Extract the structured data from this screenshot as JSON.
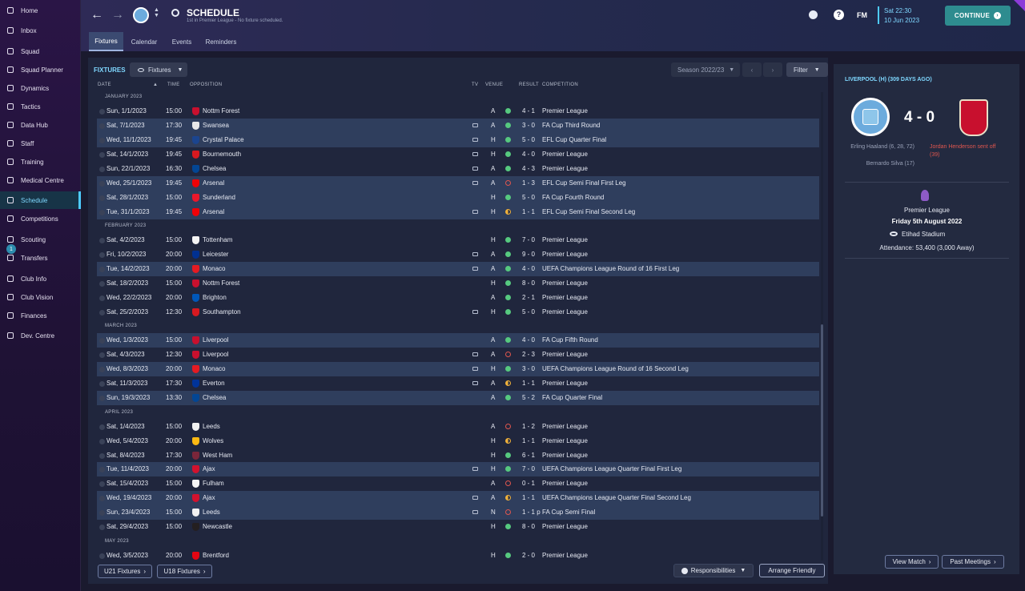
{
  "sidebar": {
    "items": [
      {
        "label": "Home",
        "icon": "home-icon"
      },
      {
        "label": "Inbox",
        "icon": "inbox-icon"
      },
      {
        "label": "Squad",
        "icon": "squad-icon"
      },
      {
        "label": "Squad Planner",
        "icon": "planner-icon"
      },
      {
        "label": "Dynamics",
        "icon": "dynamics-icon"
      },
      {
        "label": "Tactics",
        "icon": "tactics-icon"
      },
      {
        "label": "Data Hub",
        "icon": "data-hub-icon"
      },
      {
        "label": "Staff",
        "icon": "staff-icon"
      },
      {
        "label": "Training",
        "icon": "training-icon"
      },
      {
        "label": "Medical Centre",
        "icon": "medical-icon"
      },
      {
        "label": "Schedule",
        "icon": "calendar-icon"
      },
      {
        "label": "Competitions",
        "icon": "trophy-icon"
      },
      {
        "label": "Scouting",
        "icon": "scouting-icon"
      },
      {
        "label": "Transfers",
        "icon": "transfers-icon",
        "badge": "1"
      },
      {
        "label": "Club Info",
        "icon": "shield-icon"
      },
      {
        "label": "Club Vision",
        "icon": "vision-icon"
      },
      {
        "label": "Finances",
        "icon": "finances-icon"
      },
      {
        "label": "Dev. Centre",
        "icon": "dev-centre-icon"
      }
    ]
  },
  "header": {
    "title": "SCHEDULE",
    "subtitle": "1st in Premier League - No fixture scheduled.",
    "time": "Sat 22:30",
    "date": "10 Jun 2023",
    "fm_label": "FM",
    "help": "?",
    "continue_label": "CONTINUE"
  },
  "tabs": [
    "Fixtures",
    "Calendar",
    "Events",
    "Reminders"
  ],
  "fixtures_panel": {
    "title": "FIXTURES",
    "view_dropdown": "Fixtures",
    "season": "Season 2022/23",
    "filter": "Filter",
    "columns": {
      "date": "DATE",
      "time": "TIME",
      "opposition": "OPPOSITION",
      "tv": "TV",
      "venue": "VENUE",
      "result": "RESULT",
      "competition": "COMPETITION"
    },
    "months": [
      "JANUARY 2023",
      "FEBRUARY 2023",
      "MARCH 2023",
      "APRIL 2023",
      "MAY 2023"
    ],
    "rows": [
      {
        "date": "Sun, 1/1/2023",
        "time": "15:00",
        "opp": "Nottm Forest",
        "tv": false,
        "venue": "A",
        "res": "W",
        "score": "4 - 1",
        "comp": "Premier League",
        "band": false,
        "crest": "#c8102e"
      },
      {
        "date": "Sat, 7/1/2023",
        "time": "17:30",
        "opp": "Swansea",
        "tv": true,
        "venue": "A",
        "res": "W",
        "score": "3 - 0",
        "comp": "FA Cup Third Round",
        "band": true,
        "crest": "#e8e8e8"
      },
      {
        "date": "Wed, 11/1/2023",
        "time": "19:45",
        "opp": "Crystal Palace",
        "tv": true,
        "venue": "H",
        "res": "W",
        "score": "5 - 0",
        "comp": "EFL Cup Quarter Final",
        "band": true,
        "crest": "#1b458f"
      },
      {
        "date": "Sat, 14/1/2023",
        "time": "19:45",
        "opp": "Bournemouth",
        "tv": true,
        "venue": "H",
        "res": "W",
        "score": "4 - 0",
        "comp": "Premier League",
        "band": false,
        "crest": "#d71920"
      },
      {
        "date": "Sun, 22/1/2023",
        "time": "16:30",
        "opp": "Chelsea",
        "tv": true,
        "venue": "A",
        "res": "W",
        "score": "4 - 3",
        "comp": "Premier League",
        "band": false,
        "crest": "#034694"
      },
      {
        "date": "Wed, 25/1/2023",
        "time": "19:45",
        "opp": "Arsenal",
        "tv": true,
        "venue": "A",
        "res": "L",
        "score": "1 - 3",
        "comp": "EFL Cup Semi Final First Leg",
        "band": true,
        "crest": "#ef0107"
      },
      {
        "date": "Sat, 28/1/2023",
        "time": "15:00",
        "opp": "Sunderland",
        "tv": false,
        "venue": "H",
        "res": "W",
        "score": "5 - 0",
        "comp": "FA Cup Fourth Round",
        "band": true,
        "crest": "#eb172b"
      },
      {
        "date": "Tue, 31/1/2023",
        "time": "19:45",
        "opp": "Arsenal",
        "tv": true,
        "venue": "H",
        "res": "D",
        "score": "1 - 1",
        "comp": "EFL Cup Semi Final Second Leg",
        "band": true,
        "crest": "#ef0107"
      },
      {
        "date": "Sat, 4/2/2023",
        "time": "15:00",
        "opp": "Tottenham",
        "tv": false,
        "venue": "H",
        "res": "W",
        "score": "7 - 0",
        "comp": "Premier League",
        "band": false,
        "crest": "#f4f4f4"
      },
      {
        "date": "Fri, 10/2/2023",
        "time": "20:00",
        "opp": "Leicester",
        "tv": true,
        "venue": "A",
        "res": "W",
        "score": "9 - 0",
        "comp": "Premier League",
        "band": false,
        "crest": "#003090"
      },
      {
        "date": "Tue, 14/2/2023",
        "time": "20:00",
        "opp": "Monaco",
        "tv": true,
        "venue": "A",
        "res": "W",
        "score": "4 - 0",
        "comp": "UEFA Champions League Round of 16 First Leg",
        "band": true,
        "crest": "#e51b22"
      },
      {
        "date": "Sat, 18/2/2023",
        "time": "15:00",
        "opp": "Nottm Forest",
        "tv": false,
        "venue": "H",
        "res": "W",
        "score": "8 - 0",
        "comp": "Premier League",
        "band": false,
        "crest": "#c8102e"
      },
      {
        "date": "Wed, 22/2/2023",
        "time": "20:00",
        "opp": "Brighton",
        "tv": false,
        "venue": "A",
        "res": "W",
        "score": "2 - 1",
        "comp": "Premier League",
        "band": false,
        "crest": "#0057b8"
      },
      {
        "date": "Sat, 25/2/2023",
        "time": "12:30",
        "opp": "Southampton",
        "tv": true,
        "venue": "H",
        "res": "W",
        "score": "5 - 0",
        "comp": "Premier League",
        "band": false,
        "crest": "#d71920"
      },
      {
        "date": "Wed, 1/3/2023",
        "time": "15:00",
        "opp": "Liverpool",
        "tv": false,
        "venue": "A",
        "res": "W",
        "score": "4 - 0",
        "comp": "FA Cup Fifth Round",
        "band": true,
        "crest": "#c8102e"
      },
      {
        "date": "Sat, 4/3/2023",
        "time": "12:30",
        "opp": "Liverpool",
        "tv": true,
        "venue": "A",
        "res": "L",
        "score": "2 - 3",
        "comp": "Premier League",
        "band": false,
        "crest": "#c8102e"
      },
      {
        "date": "Wed, 8/3/2023",
        "time": "20:00",
        "opp": "Monaco",
        "tv": true,
        "venue": "H",
        "res": "W",
        "score": "3 - 0",
        "comp": "UEFA Champions League Round of 16 Second Leg",
        "band": true,
        "crest": "#e51b22"
      },
      {
        "date": "Sat, 11/3/2023",
        "time": "17:30",
        "opp": "Everton",
        "tv": true,
        "venue": "A",
        "res": "D",
        "score": "1 - 1",
        "comp": "Premier League",
        "band": false,
        "crest": "#003399"
      },
      {
        "date": "Sun, 19/3/2023",
        "time": "13:30",
        "opp": "Chelsea",
        "tv": false,
        "venue": "A",
        "res": "W",
        "score": "5 - 2",
        "comp": "FA Cup Quarter Final",
        "band": true,
        "crest": "#034694"
      },
      {
        "date": "Sat, 1/4/2023",
        "time": "15:00",
        "opp": "Leeds",
        "tv": false,
        "venue": "A",
        "res": "L",
        "score": "1 - 2",
        "comp": "Premier League",
        "band": false,
        "crest": "#f1f1f1"
      },
      {
        "date": "Wed, 5/4/2023",
        "time": "20:00",
        "opp": "Wolves",
        "tv": false,
        "venue": "H",
        "res": "D",
        "score": "1 - 1",
        "comp": "Premier League",
        "band": false,
        "crest": "#fdb913"
      },
      {
        "date": "Sat, 8/4/2023",
        "time": "17:30",
        "opp": "West Ham",
        "tv": false,
        "venue": "H",
        "res": "W",
        "score": "6 - 1",
        "comp": "Premier League",
        "band": false,
        "crest": "#7a263a"
      },
      {
        "date": "Tue, 11/4/2023",
        "time": "20:00",
        "opp": "Ajax",
        "tv": true,
        "venue": "H",
        "res": "W",
        "score": "7 - 0",
        "comp": "UEFA Champions League Quarter Final First Leg",
        "band": true,
        "crest": "#d2122e"
      },
      {
        "date": "Sat, 15/4/2023",
        "time": "15:00",
        "opp": "Fulham",
        "tv": false,
        "venue": "A",
        "res": "L",
        "score": "0 - 1",
        "comp": "Premier League",
        "band": false,
        "crest": "#f5f5f5"
      },
      {
        "date": "Wed, 19/4/2023",
        "time": "20:00",
        "opp": "Ajax",
        "tv": true,
        "venue": "A",
        "res": "D",
        "score": "1 - 1",
        "comp": "UEFA Champions League Quarter Final Second Leg",
        "band": true,
        "crest": "#d2122e"
      },
      {
        "date": "Sun, 23/4/2023",
        "time": "15:00",
        "opp": "Leeds",
        "tv": true,
        "venue": "N",
        "res": "L",
        "score": "1 - 1 p",
        "comp": "FA Cup Semi Final",
        "band": true,
        "crest": "#f1f1f1"
      },
      {
        "date": "Sat, 29/4/2023",
        "time": "15:00",
        "opp": "Newcastle",
        "tv": false,
        "venue": "H",
        "res": "W",
        "score": "8 - 0",
        "comp": "Premier League",
        "band": false,
        "crest": "#241f20"
      },
      {
        "date": "Wed, 3/5/2023",
        "time": "20:00",
        "opp": "Brentford",
        "tv": false,
        "venue": "H",
        "res": "W",
        "score": "2 - 0",
        "comp": "Premier League",
        "band": false,
        "crest": "#e30613"
      }
    ],
    "footer": {
      "u21": "U21 Fixtures",
      "u18": "U18 Fixtures",
      "responsibilities": "Responsibilities",
      "arrange": "Arrange Friendly"
    }
  },
  "match_panel": {
    "title": "LIVERPOOL (H) (309 DAYS AGO)",
    "score": "4 - 0",
    "home_scorers": "Erling Haaland (6, 28, 72)",
    "home_scorers_2": "Bernardo Silva (17)",
    "away_event": "Jordan Henderson sent off (39)",
    "competition": "Premier League",
    "date": "Friday 5th August 2022",
    "stadium": "Etihad Stadium",
    "attendance": "Attendance: 53,400 (3,000 Away)",
    "view_match": "View Match",
    "past_meetings": "Past Meetings",
    "colors": {
      "home": "#6cabdd",
      "away": "#c8102e"
    }
  },
  "colors": {
    "accent": "#4ecbff",
    "win": "#56c97f",
    "loss": "#e0564e",
    "draw": "#f0b13a",
    "continue": "#2e8c8f"
  }
}
